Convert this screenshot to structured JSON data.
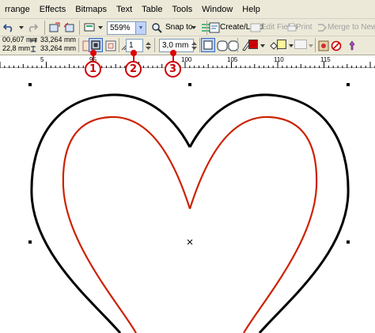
{
  "menu": {
    "items": [
      "rrange",
      "Effects",
      "Bitmaps",
      "Text",
      "Table",
      "Tools",
      "Window",
      "Help"
    ]
  },
  "toolbar": {
    "zoom_value": "559%",
    "snap_label": "Snap to",
    "create_load_label": "Create/Load",
    "edit_fields_label": "Edit Fields",
    "print_label": "Print",
    "merge_label": "Merge to New Document"
  },
  "property_bar": {
    "x_value": "00,607 mm",
    "y_value": "22,8 mm",
    "width_value": "33,264 mm",
    "height_value": "33,264 mm",
    "outline_value": "1",
    "offset_value": "3,0 mm"
  },
  "ruler": {
    "labels": [
      "5",
      "95",
      "100",
      "105",
      "110",
      "115"
    ]
  },
  "callouts": [
    "1",
    "2",
    "3"
  ],
  "colors": {
    "outer_heart": "#000000",
    "inner_heart": "#cc2200",
    "callout": "#cc0000"
  }
}
